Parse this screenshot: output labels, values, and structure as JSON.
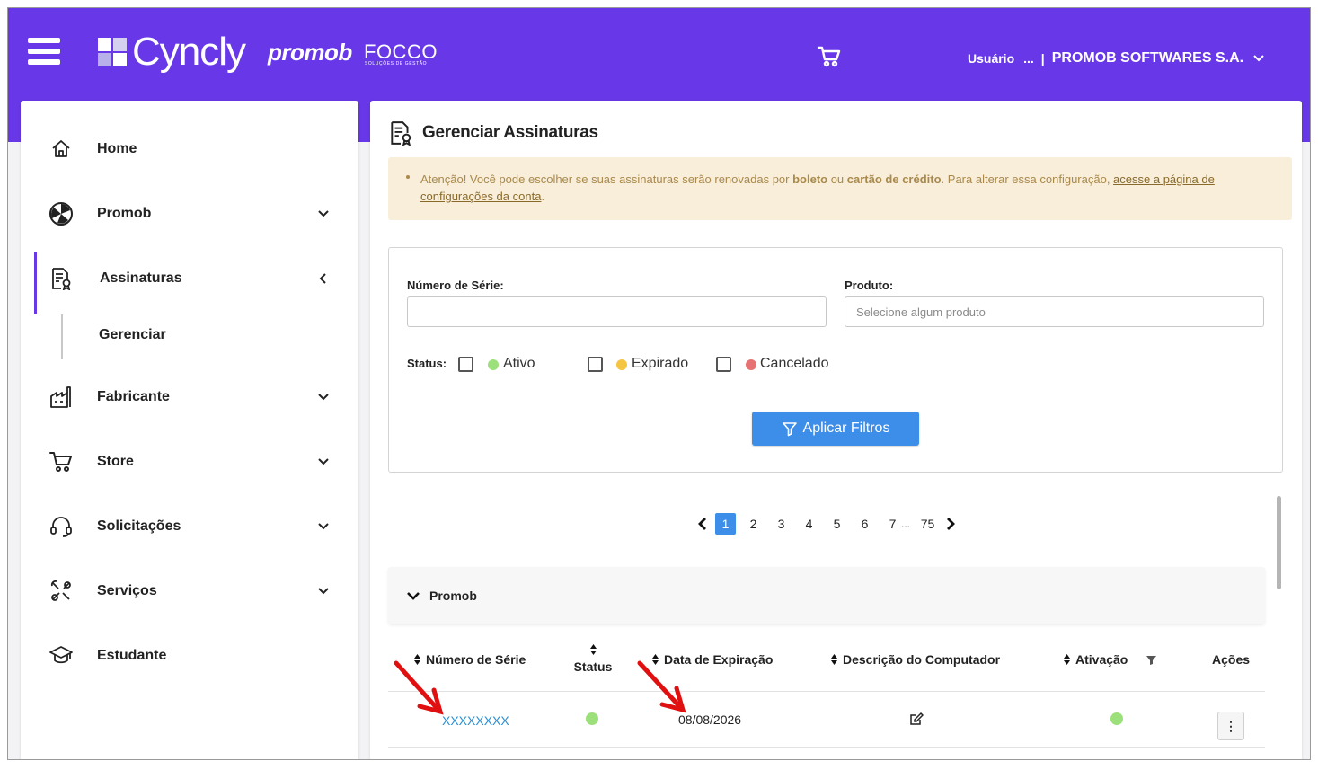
{
  "header": {
    "brand": "Cyncly",
    "brand2": "promob",
    "brand3": "FOCCO",
    "brand3_sub": "SOLUÇÕES DE GESTÃO",
    "user_label": "Usuário",
    "user_ellipsis": "...",
    "separator": "|",
    "company": "PROMOB SOFTWARES S.A."
  },
  "sidebar": {
    "items": [
      {
        "label": "Home",
        "icon": "home-icon"
      },
      {
        "label": "Promob",
        "icon": "promob-icon"
      },
      {
        "label": "Assinaturas",
        "icon": "subscription-icon"
      },
      {
        "label": "Fabricante",
        "icon": "factory-icon"
      },
      {
        "label": "Store",
        "icon": "cart-icon"
      },
      {
        "label": "Solicitações",
        "icon": "headset-icon"
      },
      {
        "label": "Serviços",
        "icon": "tools-icon"
      },
      {
        "label": "Estudante",
        "icon": "graduation-icon"
      }
    ],
    "sub_item": "Gerenciar"
  },
  "main": {
    "title": "Gerenciar Assinaturas",
    "alert": {
      "part1": "Atenção! Você pode escolher se suas assinaturas serão renovadas por ",
      "bold1": "boleto",
      "part2": " ou ",
      "bold2": "cartão de crédito",
      "part3": ". Para alterar essa configuração, ",
      "link": "acesse a página de configurações da conta",
      "part4": "."
    },
    "filters": {
      "serial_label": "Número de Série:",
      "serial_value": "",
      "product_label": "Produto:",
      "product_placeholder": "Selecione algum produto",
      "status_label": "Status:",
      "statuses": [
        {
          "label": "Ativo",
          "color": "#9be07a",
          "checked": false
        },
        {
          "label": "Expirado",
          "color": "#f5c542",
          "checked": false
        },
        {
          "label": "Cancelado",
          "color": "#e57373",
          "checked": false
        }
      ],
      "apply_label": "Aplicar Filtros"
    },
    "pagination": {
      "pages": [
        "1",
        "2",
        "3",
        "4",
        "5",
        "6",
        "7"
      ],
      "current": "1",
      "ellipsis": "...",
      "last": "75"
    },
    "group": {
      "name": "Promob"
    },
    "table": {
      "headers": {
        "serial": "Número de Série",
        "status": "Status",
        "expiration": "Data de Expiração",
        "computer": "Descrição do Computador",
        "activation": "Ativação",
        "actions": "Ações"
      },
      "rows": [
        {
          "serial": "XXXXXXXX",
          "status_color": "#9be07a",
          "expiration": "08/08/2026",
          "activation_color": "#9be07a",
          "actions_label": "⋮"
        }
      ]
    }
  },
  "colors": {
    "brand": "#6838e8",
    "primary": "#3d8ee8",
    "alert_bg": "#f8eeda",
    "annotation": "#e01010"
  }
}
